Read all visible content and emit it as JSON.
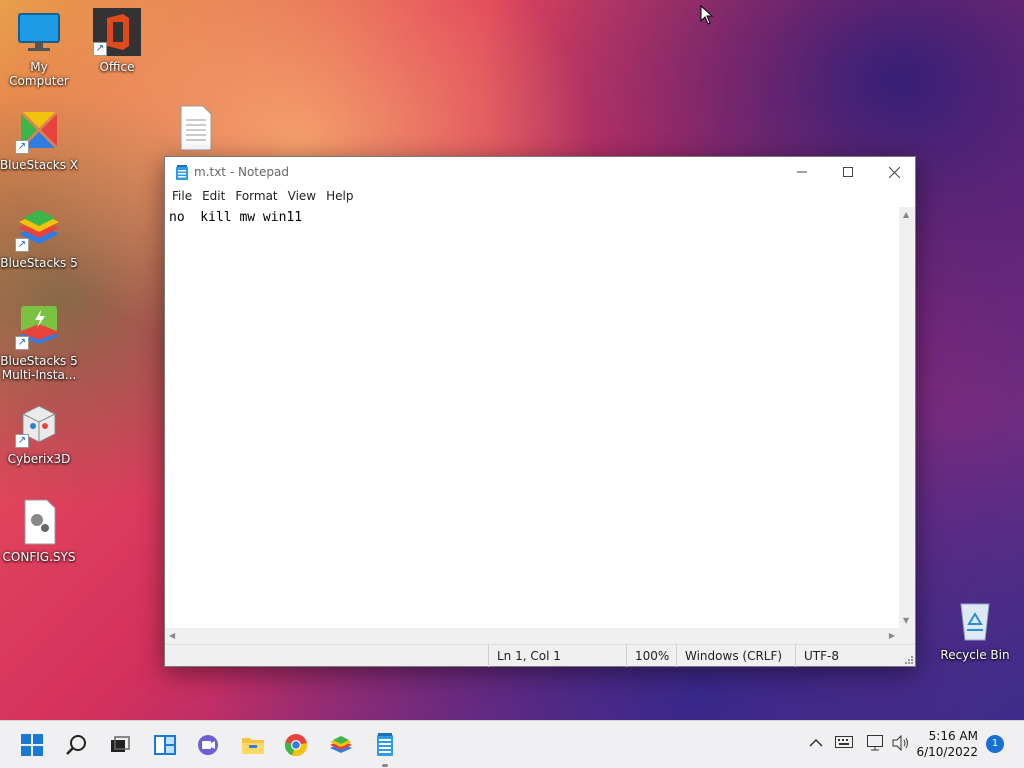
{
  "desktop": {
    "icons": [
      {
        "label": "My Computer"
      },
      {
        "label": "Office"
      },
      {
        "label": "BlueStacks X"
      },
      {
        "label": "BlueStacks 5"
      },
      {
        "label": "BlueStacks 5 Multi-Insta..."
      },
      {
        "label": "Cyberix3D"
      },
      {
        "label": "CONFIG.SYS"
      },
      {
        "label": "Recycle Bin"
      }
    ]
  },
  "notepad": {
    "title": "m.txt - Notepad",
    "menu": [
      "File",
      "Edit",
      "Format",
      "View",
      "Help"
    ],
    "content": "no  kill mw win11",
    "status": {
      "position": "Ln 1, Col 1",
      "zoom": "100%",
      "line_ending": "Windows (CRLF)",
      "encoding": "UTF-8"
    }
  },
  "taskbar": {
    "apps": [
      "start-icon",
      "search-icon",
      "task-view-icon",
      "widgets-icon",
      "chat-icon",
      "file-explorer-icon",
      "chrome-icon",
      "bluestacks-icon",
      "notepad-icon"
    ],
    "clock": {
      "time": "5:16 AM",
      "date": "6/10/2022"
    },
    "notification_count": "1"
  },
  "colors": {
    "accent": "#1a6fd6",
    "windows_blue": "#0078d4"
  }
}
